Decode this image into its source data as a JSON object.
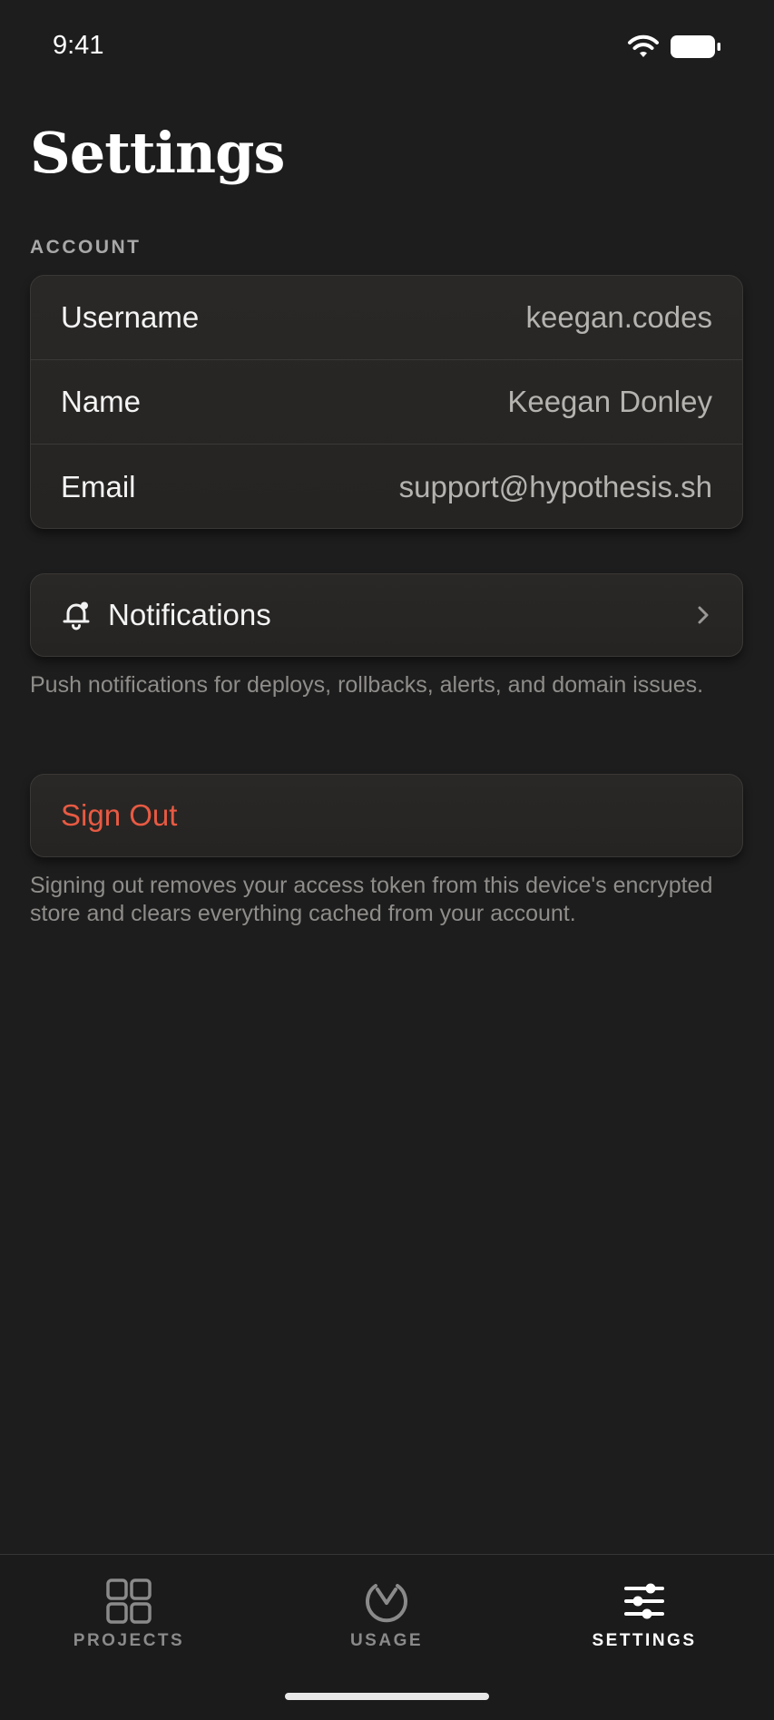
{
  "status_bar": {
    "time": "9:41",
    "wifi_icon": "wifi-icon",
    "battery_icon": "battery-icon"
  },
  "page": {
    "title": "Settings"
  },
  "account": {
    "section_title": "ACCOUNT",
    "rows": [
      {
        "label": "Username",
        "value": "keegan.codes"
      },
      {
        "label": "Name",
        "value": "Keegan Donley"
      },
      {
        "label": "Email",
        "value": "support@hypothesis.sh"
      }
    ]
  },
  "notifications": {
    "icon": "bell-icon",
    "label": "Notifications",
    "chevron_icon": "chevron-right-icon",
    "footnote": "Push notifications for deploys, rollbacks, alerts, and domain issues."
  },
  "sign_out": {
    "label": "Sign Out",
    "color": "#e85a43",
    "footnote": "Signing out removes your access token from this device's encrypted store and clears everything cached from your account."
  },
  "tab_bar": {
    "active": "SETTINGS",
    "tabs": [
      {
        "label": "PROJECTS",
        "icon": "grid-icon"
      },
      {
        "label": "USAGE",
        "icon": "gauge-icon"
      },
      {
        "label": "SETTINGS",
        "icon": "sliders-icon"
      }
    ]
  },
  "colors": {
    "background": "#1d1d1d",
    "card": "#282624",
    "destructive": "#e85a43",
    "secondary_text": "#8f8d8a"
  }
}
